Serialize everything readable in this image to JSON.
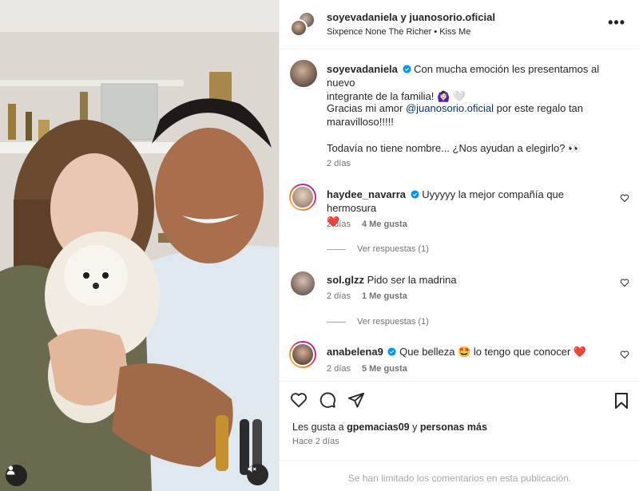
{
  "media": {
    "icons": {
      "account": "user-icon",
      "mute": "speaker-muted-icon"
    }
  },
  "header": {
    "title": "soyevadaniela y juanosorio.oficial",
    "song": "Sixpence None The Richer • Kiss Me",
    "more_icon": "more-horizontal-icon"
  },
  "caption": {
    "username": "soyevadaniela",
    "line1_text": "Con mucha emoción les presentamos al nuevo",
    "line2_text": "integrante de la familia! 🙆🏻‍♀️ 🤍",
    "line3_pre": "Gracias mi amor ",
    "line3_mention": "@juanosorio.oficial",
    "line3_post": " por este regalo tan",
    "line4_text": "maravilloso!!!!!",
    "line5_text": "Todavía no tiene nombre... ¿Nos ayudan a elegirlo? 👀",
    "time": "2 días"
  },
  "comments": [
    {
      "username": "haydee_navarra",
      "text_line1": "Uyyyyy la mejor compañía que hermosura",
      "text_line2": "❤️",
      "time": "2 días",
      "likes": "4 Me gusta",
      "replies": "Ver respuestas (1)"
    },
    {
      "username": "sol.glzz",
      "text_line1": "Pido ser la madrina",
      "time": "2 días",
      "likes": "1 Me gusta",
      "replies": "Ver respuestas (1)"
    },
    {
      "username": "anabelena9",
      "text_line1": "Que belleza 🤩 lo tengo que conocer ❤️",
      "time": "2 días",
      "likes": "5 Me gusta"
    }
  ],
  "actions": {
    "likes_prefix": "Les gusta a ",
    "likes_user": "gpemacias09",
    "likes_mid": " y ",
    "likes_rest": "personas más",
    "posted": "Hace 2 días",
    "limited": "Se han limitado los comentarios en esta publicación.",
    "icons": [
      "heart-icon",
      "comment-icon",
      "share-icon",
      "bookmark-icon"
    ]
  },
  "colors": {
    "mention": "#00376b",
    "verified": "#0095f6",
    "like_red": "#ed4956",
    "muted_text": "#737373"
  }
}
